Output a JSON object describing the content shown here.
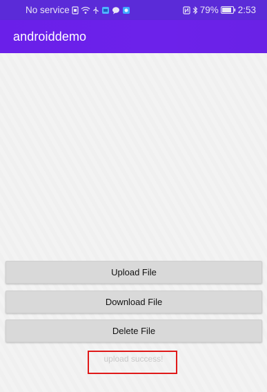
{
  "status_bar": {
    "carrier": "No service",
    "battery_percent": "79%",
    "time": "2:53",
    "icons_left": [
      "sim-icon",
      "wifi-icon",
      "usb-icon",
      "app-notification-icon",
      "chat-icon",
      "media-icon"
    ],
    "icons_right": [
      "nfc-icon",
      "bluetooth-icon",
      "battery-icon"
    ]
  },
  "app_bar": {
    "title": "androiddemo"
  },
  "buttons": {
    "upload_label": "Upload File",
    "download_label": "Download File",
    "delete_label": "Delete File"
  },
  "result": {
    "message": "upload success!"
  },
  "colors": {
    "status_bar": "#5b2bd8",
    "app_bar": "#6a1fe9",
    "button": "#d9d9d9",
    "highlight_border": "#e01818",
    "result_text": "#c9c9c9"
  }
}
